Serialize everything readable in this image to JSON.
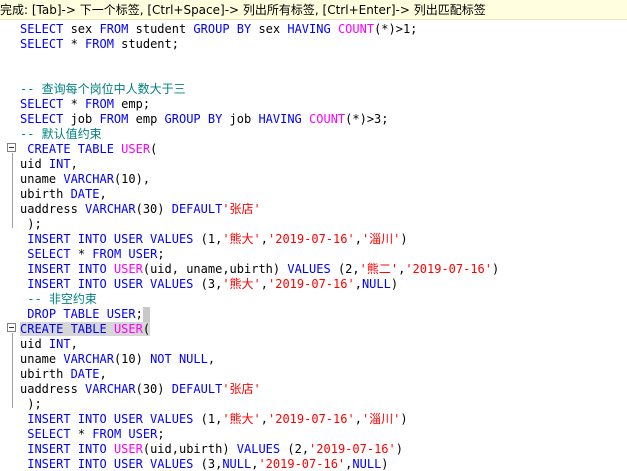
{
  "status_bar": {
    "text": "完成: [Tab]-> 下一个标签, [Ctrl+Space]-> 列出所有标签, [Ctrl+Enter]-> 列出匹配标签"
  },
  "editor": {
    "lines": [
      [
        [
          "kw",
          "SELECT"
        ],
        [
          "t",
          " sex "
        ],
        [
          "kw",
          "FROM"
        ],
        [
          "t",
          " student "
        ],
        [
          "kw",
          "GROUP BY"
        ],
        [
          "t",
          " sex "
        ],
        [
          "kw",
          "HAVING"
        ],
        [
          "t",
          " "
        ],
        [
          "fn",
          "COUNT"
        ],
        [
          "t",
          "(*)>1;"
        ]
      ],
      [
        [
          "kw",
          "SELECT"
        ],
        [
          "t",
          " * "
        ],
        [
          "kw",
          "FROM"
        ],
        [
          "t",
          " student;"
        ]
      ],
      [],
      [],
      [
        [
          "cmt",
          "-- 查询每个岗位中人数大于三"
        ]
      ],
      [
        [
          "kw",
          "SELECT"
        ],
        [
          "t",
          " * "
        ],
        [
          "kw",
          "FROM"
        ],
        [
          "t",
          " emp;"
        ]
      ],
      [
        [
          "kw",
          "SELECT"
        ],
        [
          "t",
          " job "
        ],
        [
          "kw",
          "FROM"
        ],
        [
          "t",
          " emp "
        ],
        [
          "kw",
          "GROUP BY"
        ],
        [
          "t",
          " job "
        ],
        [
          "kw",
          "HAVING"
        ],
        [
          "t",
          " "
        ],
        [
          "fn",
          "COUNT"
        ],
        [
          "t",
          "(*)>3;"
        ]
      ],
      [
        [
          "cmt",
          "-- 默认值约束"
        ]
      ],
      [
        [
          "t",
          " "
        ],
        [
          "kw",
          "CREATE TABLE"
        ],
        [
          "t",
          " "
        ],
        [
          "fn",
          "USER"
        ],
        [
          "t",
          "("
        ]
      ],
      [
        [
          "t",
          "uid "
        ],
        [
          "kw",
          "INT"
        ],
        [
          "t",
          ","
        ]
      ],
      [
        [
          "t",
          "uname "
        ],
        [
          "kw",
          "VARCHAR"
        ],
        [
          "t",
          "(10),"
        ]
      ],
      [
        [
          "t",
          "ubirth "
        ],
        [
          "kw",
          "DATE"
        ],
        [
          "t",
          ","
        ]
      ],
      [
        [
          "t",
          "uaddress "
        ],
        [
          "kw",
          "VARCHAR"
        ],
        [
          "t",
          "(30) "
        ],
        [
          "kw",
          "DEFAULT"
        ],
        [
          "str",
          "'张店'"
        ]
      ],
      [
        [
          "t",
          " );"
        ]
      ],
      [
        [
          "t",
          " "
        ],
        [
          "kw",
          "INSERT INTO USER VALUES"
        ],
        [
          "t",
          " (1,"
        ],
        [
          "str",
          "'熊大'"
        ],
        [
          "t",
          ","
        ],
        [
          "str",
          "'2019-07-16'"
        ],
        [
          "t",
          ","
        ],
        [
          "str",
          "'淄川'"
        ],
        [
          "t",
          ")"
        ]
      ],
      [
        [
          "t",
          " "
        ],
        [
          "kw",
          "SELECT"
        ],
        [
          "t",
          " * "
        ],
        [
          "kw",
          "FROM USER"
        ],
        [
          "t",
          ";"
        ]
      ],
      [
        [
          "t",
          " "
        ],
        [
          "kw",
          "INSERT INTO"
        ],
        [
          "t",
          " "
        ],
        [
          "fn",
          "USER"
        ],
        [
          "t",
          "(uid, uname,ubirth) "
        ],
        [
          "kw",
          "VALUES"
        ],
        [
          "t",
          " (2,"
        ],
        [
          "str",
          "'熊二'"
        ],
        [
          "t",
          ","
        ],
        [
          "str",
          "'2019-07-16'"
        ],
        [
          "t",
          ")"
        ]
      ],
      [
        [
          "t",
          " "
        ],
        [
          "kw",
          "INSERT INTO USER VALUES"
        ],
        [
          "t",
          " (3,"
        ],
        [
          "str",
          "'熊大'"
        ],
        [
          "t",
          ","
        ],
        [
          "str",
          "'2019-07-16'"
        ],
        [
          "t",
          ","
        ],
        [
          "kw",
          "NULL"
        ],
        [
          "t",
          ")"
        ]
      ],
      [
        [
          "t",
          " "
        ],
        [
          "cmt",
          "-- 非空约束"
        ]
      ],
      [
        [
          "t",
          " "
        ],
        [
          "kw",
          "DROP TABLE USER"
        ],
        [
          "t",
          ";"
        ]
      ],
      [
        [
          "kw",
          "CREATE TABLE"
        ],
        [
          "t",
          " "
        ],
        [
          "fn",
          "USER"
        ],
        [
          "t",
          "("
        ]
      ],
      [
        [
          "t",
          "uid "
        ],
        [
          "kw",
          "INT"
        ],
        [
          "t",
          ","
        ]
      ],
      [
        [
          "t",
          "uname "
        ],
        [
          "kw",
          "VARCHAR"
        ],
        [
          "t",
          "(10) "
        ],
        [
          "kw",
          "NOT NULL"
        ],
        [
          "t",
          ","
        ]
      ],
      [
        [
          "t",
          "ubirth "
        ],
        [
          "kw",
          "DATE"
        ],
        [
          "t",
          ","
        ]
      ],
      [
        [
          "t",
          "uaddress "
        ],
        [
          "kw",
          "VARCHAR"
        ],
        [
          "t",
          "(30) "
        ],
        [
          "kw",
          "DEFAULT"
        ],
        [
          "str",
          "'张店'"
        ]
      ],
      [
        [
          "t",
          " );"
        ]
      ],
      [
        [
          "t",
          " "
        ],
        [
          "kw",
          "INSERT INTO USER VALUES"
        ],
        [
          "t",
          " (1,"
        ],
        [
          "str",
          "'熊大'"
        ],
        [
          "t",
          ","
        ],
        [
          "str",
          "'2019-07-16'"
        ],
        [
          "t",
          ","
        ],
        [
          "str",
          "'淄川'"
        ],
        [
          "t",
          ")"
        ]
      ],
      [
        [
          "t",
          " "
        ],
        [
          "kw",
          "SELECT"
        ],
        [
          "t",
          " * "
        ],
        [
          "kw",
          "FROM USER"
        ],
        [
          "t",
          ";"
        ]
      ],
      [
        [
          "t",
          " "
        ],
        [
          "kw",
          "INSERT INTO"
        ],
        [
          "t",
          " "
        ],
        [
          "fn",
          "USER"
        ],
        [
          "t",
          "(uid,ubirth) "
        ],
        [
          "kw",
          "VALUES"
        ],
        [
          "t",
          " (2,"
        ],
        [
          "str",
          "'2019-07-16'"
        ],
        [
          "t",
          ")"
        ]
      ],
      [
        [
          "t",
          " "
        ],
        [
          "kw",
          "INSERT INTO USER VALUES"
        ],
        [
          "t",
          " (3,"
        ],
        [
          "kw",
          "NULL"
        ],
        [
          "t",
          ","
        ],
        [
          "str",
          "'2019-07-16'"
        ],
        [
          "t",
          ","
        ],
        [
          "kw",
          "NULL"
        ],
        [
          "t",
          ")"
        ]
      ]
    ],
    "selected_line": 20,
    "caret_line": 19,
    "fold_markers": [
      "fold-icon",
      "fold-icon"
    ],
    "colors": {
      "keyword": "#0000ff",
      "function": "#ff00ff",
      "string": "#ff0000",
      "comment": "#008080",
      "status_bg": "#ffffdf",
      "selection": "#d6d6d6"
    }
  }
}
